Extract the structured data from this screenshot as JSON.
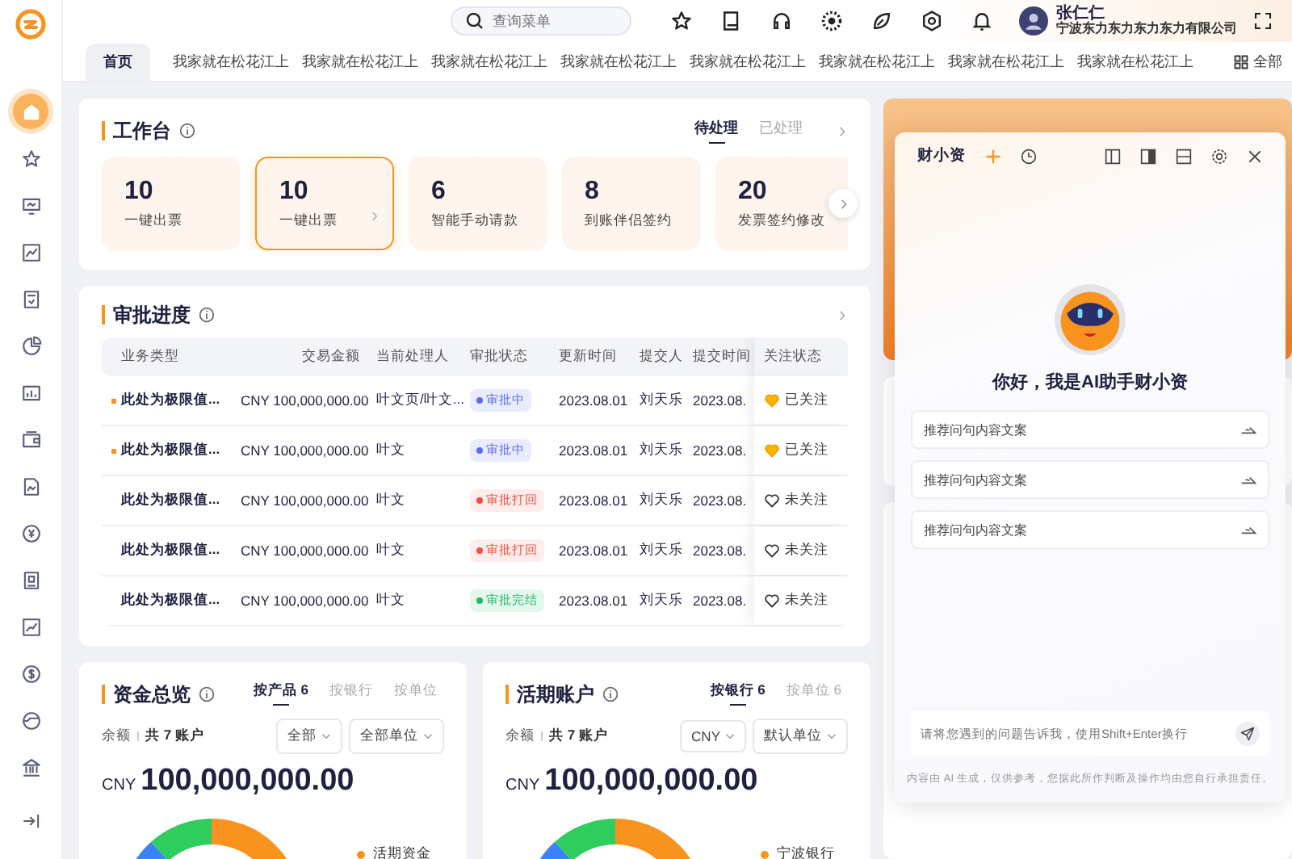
{
  "sidebar": {
    "items": [
      {
        "selected": true
      },
      {
        "selected": false
      },
      {
        "selected": false
      },
      {
        "selected": false
      },
      {
        "selected": false
      },
      {
        "selected": false
      },
      {
        "selected": false
      },
      {
        "selected": false
      },
      {
        "selected": false
      },
      {
        "selected": false
      },
      {
        "selected": false
      },
      {
        "selected": false
      },
      {
        "selected": false
      },
      {
        "selected": false
      },
      {
        "selected": false
      }
    ]
  },
  "header": {
    "search": {
      "placeholder": "查询菜单"
    },
    "user": {
      "name": "张仁仁",
      "company": "宁波东力东力东力东力有限公司"
    }
  },
  "tabs": [
    {
      "label": "首页",
      "selected": true
    },
    {
      "label": "我家就在松花江上",
      "selected": false
    },
    {
      "label": "我家就在松花江上",
      "selected": false
    },
    {
      "label": "我家就在松花江上",
      "selected": false
    },
    {
      "label": "我家就在松花江上",
      "selected": false
    },
    {
      "label": "我家就在松花江上",
      "selected": false
    },
    {
      "label": "我家就在松花江上",
      "selected": false
    },
    {
      "label": "我家就在松花江上",
      "selected": false
    },
    {
      "label": "我家就在松花江上",
      "selected": false
    }
  ],
  "all_tabs": {
    "label": "全部"
  },
  "workbench": {
    "title": "工作台",
    "filters": [
      {
        "label": "待处理",
        "selected": true
      },
      {
        "label": "已处理",
        "selected": false
      }
    ],
    "cards": [
      {
        "value": "10",
        "label": "一键出票",
        "selected": false
      },
      {
        "value": "10",
        "label": "一键出票",
        "selected": true
      },
      {
        "value": "6",
        "label": "智能手动请款",
        "selected": false
      },
      {
        "value": "8",
        "label": "到账伴侣签约",
        "selected": false
      },
      {
        "value": "20",
        "label": "发票签约修改",
        "selected": false
      }
    ]
  },
  "approval": {
    "title": "审批进度",
    "columns": [
      "业务类型",
      "交易金额",
      "当前处理人",
      "审批状态",
      "更新时间",
      "提交人",
      "提交时间",
      "关注状态"
    ],
    "rows": [
      {
        "flagged": true,
        "type": "此处为极限值...",
        "amount": "CNY 100,000,000.00",
        "handler": "叶文页/叶文...",
        "status": {
          "text": "审批中",
          "kind": "processing"
        },
        "updated": "2023.08.01",
        "submitter": "刘天乐",
        "submitted": "2023.08.",
        "follow": {
          "text": "已关注",
          "followed": true
        }
      },
      {
        "flagged": true,
        "type": "此处为极限值...",
        "amount": "CNY 100,000,000.00",
        "handler": "叶文",
        "status": {
          "text": "审批中",
          "kind": "processing"
        },
        "updated": "2023.08.01",
        "submitter": "刘天乐",
        "submitted": "2023.08.",
        "follow": {
          "text": "已关注",
          "followed": true
        }
      },
      {
        "flagged": false,
        "type": "此处为极限值...",
        "amount": "CNY 100,000,000.00",
        "handler": "叶文",
        "status": {
          "text": "审批打回",
          "kind": "rejected"
        },
        "updated": "2023.08.01",
        "submitter": "刘天乐",
        "submitted": "2023.08.",
        "follow": {
          "text": "未关注",
          "followed": false
        }
      },
      {
        "flagged": false,
        "type": "此处为极限值...",
        "amount": "CNY 100,000,000.00",
        "handler": "叶文",
        "status": {
          "text": "审批打回",
          "kind": "rejected"
        },
        "updated": "2023.08.01",
        "submitter": "刘天乐",
        "submitted": "2023.08.",
        "follow": {
          "text": "未关注",
          "followed": false
        }
      },
      {
        "flagged": false,
        "type": "此处为极限值...",
        "amount": "CNY 100,000,000.00",
        "handler": "叶文",
        "status": {
          "text": "审批完结",
          "kind": "done"
        },
        "updated": "2023.08.01",
        "submitter": "刘天乐",
        "submitted": "2023.08.",
        "follow": {
          "text": "未关注",
          "followed": false
        }
      }
    ]
  },
  "balance_cards": [
    {
      "title": "资金总览",
      "tabs": [
        {
          "label": "按产品 6",
          "selected": true
        },
        {
          "label": "按银行",
          "selected": false
        },
        {
          "label": "按单位",
          "selected": false
        }
      ],
      "balance_label": "余额",
      "accounts": "共 7 账户",
      "selects": [
        "全部",
        "全部单位"
      ],
      "currency": "CNY",
      "amount": "100,000,000.00",
      "legend": [
        "活期资金"
      ]
    },
    {
      "title": "活期账户",
      "tabs": [
        {
          "label": "按银行 6",
          "selected": true
        },
        {
          "label": "按单位 6",
          "selected": false
        }
      ],
      "balance_label": "余额",
      "accounts": "共 7 账户",
      "selects": [
        "CNY",
        "默认单位"
      ],
      "currency": "CNY",
      "amount": "100,000,000.00",
      "legend": [
        "宁波银行"
      ]
    }
  ],
  "assistant": {
    "title": "财小资",
    "greeting": "你好，我是AI助手财小资",
    "suggestions": [
      "推荐问句内容文案",
      "推荐问句内容文案",
      "推荐问句内容文案"
    ],
    "input": {
      "placeholder": "请将您遇到的问题告诉我，使用Shift+Enter换行"
    },
    "disclaimer": "内容由 AI 生成，仅供参考，您据此所作判断及操作均由您自行承担责任。"
  }
}
